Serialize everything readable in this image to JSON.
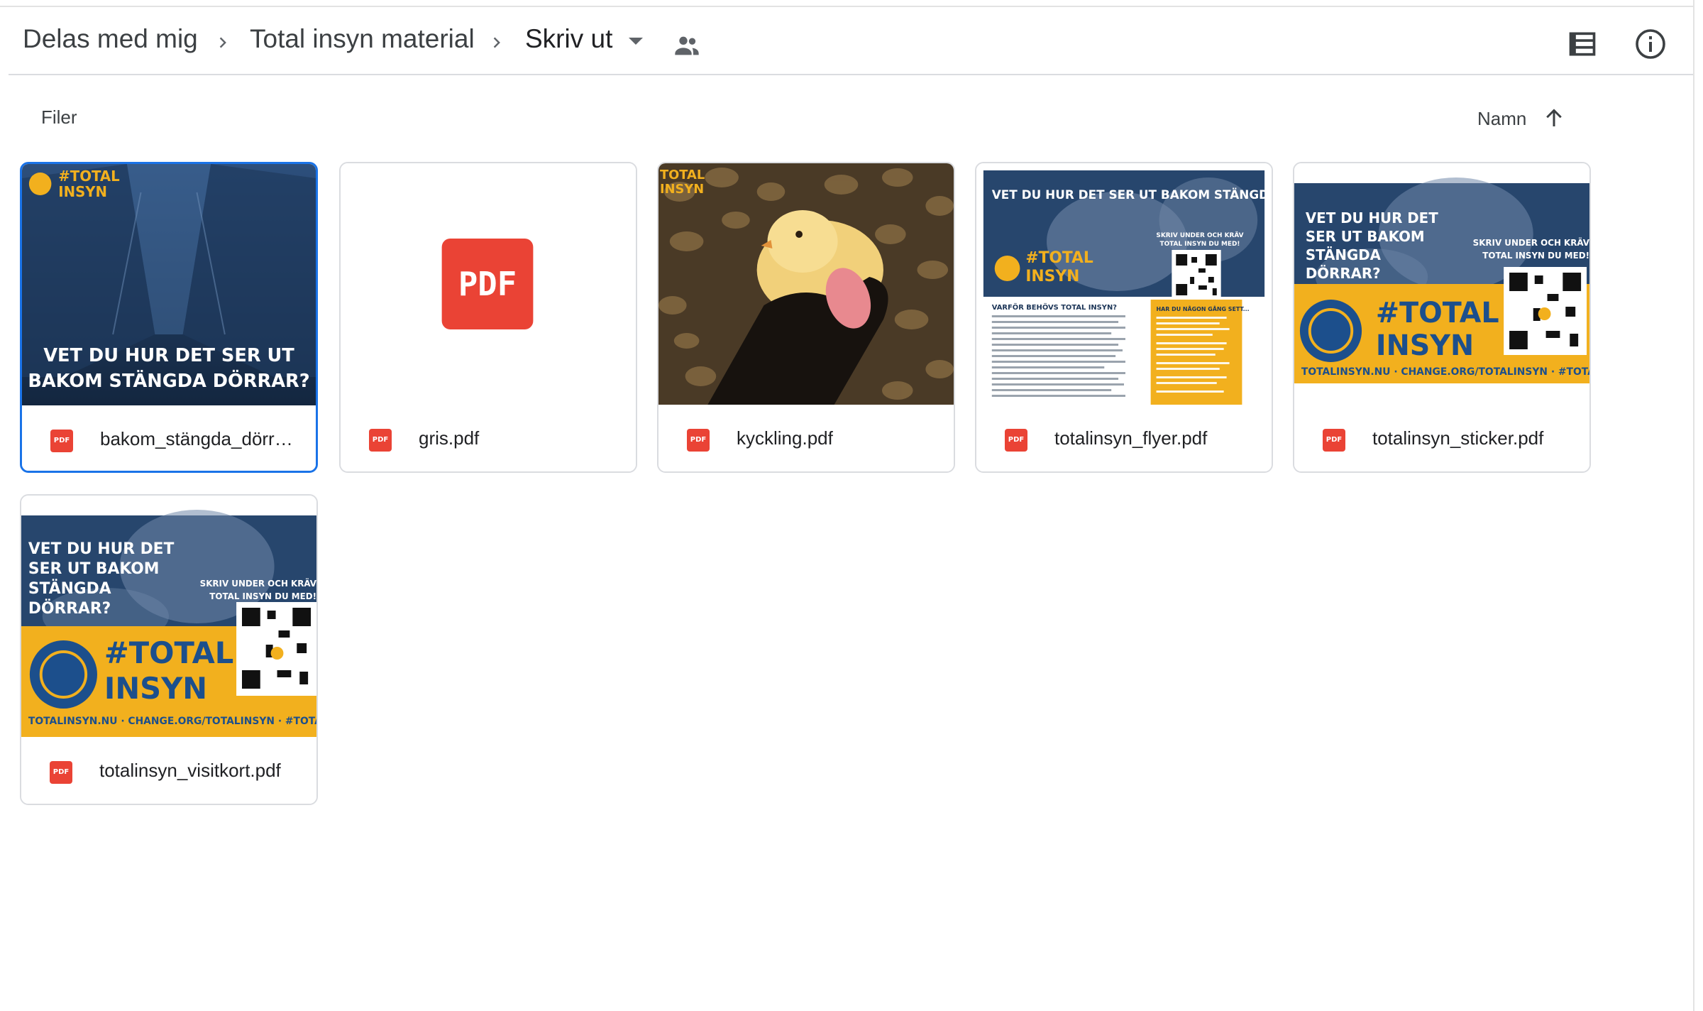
{
  "breadcrumb": {
    "items": [
      {
        "label": "Delas med mig"
      },
      {
        "label": "Total insyn material"
      },
      {
        "label": "Skriv ut"
      }
    ]
  },
  "toolbar": {
    "section_label": "Filer",
    "sort_label": "Namn",
    "sort_direction": "ascending"
  },
  "files": [
    {
      "name": "bakom_stängda_dörr…",
      "type": "pdf",
      "type_badge": "PDF",
      "selected": true,
      "thumb": {
        "headline_1": "VET DU HUR DET SER UT",
        "headline_2": "BAKOM STÄNGDA DÖRRAR?",
        "logo_1": "#TOTAL",
        "logo_2": "INSYN"
      }
    },
    {
      "name": "gris.pdf",
      "type": "pdf",
      "type_badge": "PDF",
      "selected": false,
      "thumb": {
        "pdf_label": "PDF"
      }
    },
    {
      "name": "kyckling.pdf",
      "type": "pdf",
      "type_badge": "PDF",
      "selected": false,
      "thumb": {
        "logo_1": "TOTAL",
        "logo_2": "INSYN"
      }
    },
    {
      "name": "totalinsyn_flyer.pdf",
      "type": "pdf",
      "type_badge": "PDF",
      "selected": false,
      "thumb": {
        "headline": "VET DU HUR DET SER UT BAKOM STÄNGDA DÖRRAR?",
        "logo_1": "#TOTAL",
        "logo_2": "INSYN",
        "cta_1": "SKRIV UNDER OCH KRÄV",
        "cta_2": "TOTAL INSYN DU MED!",
        "subhead": "VARFÖR BEHÖVS TOTAL INSYN?",
        "side_head": "HAR DU NÅGON GÅNG SETT..."
      }
    },
    {
      "name": "totalinsyn_sticker.pdf",
      "type": "pdf",
      "type_badge": "PDF",
      "selected": false,
      "thumb": {
        "q1": "VET DU HUR DET",
        "q2": "SER UT BAKOM",
        "q3": "STÄNGDA",
        "q4": "DÖRRAR?",
        "cta_1": "SKRIV UNDER OCH KRÄV",
        "cta_2": "TOTAL INSYN DU MED!",
        "logo_1": "#TOTAL",
        "logo_2": "INSYN",
        "footer": "TOTALINSYN.NU · CHANGE.ORG/TOTALINSYN · #TOTALINSYN"
      }
    },
    {
      "name": "totalinsyn_visitkort.pdf",
      "type": "pdf",
      "type_badge": "PDF",
      "selected": false,
      "thumb": {
        "q1": "VET DU HUR DET",
        "q2": "SER UT BAKOM",
        "q3": "STÄNGDA",
        "q4": "DÖRRAR?",
        "cta_1": "SKRIV UNDER OCH KRÄV",
        "cta_2": "TOTAL INSYN DU MED!",
        "logo_1": "#TOTAL",
        "logo_2": "INSYN",
        "footer": "TOTALINSYN.NU · CHANGE.ORG/TOTALINSYN · #TOTALINSYN"
      }
    }
  ],
  "colors": {
    "accent": "#1a73e8",
    "pdf_red": "#ea4335",
    "campaign_navy": "#1c3557",
    "campaign_yellow": "#f2b01e"
  }
}
